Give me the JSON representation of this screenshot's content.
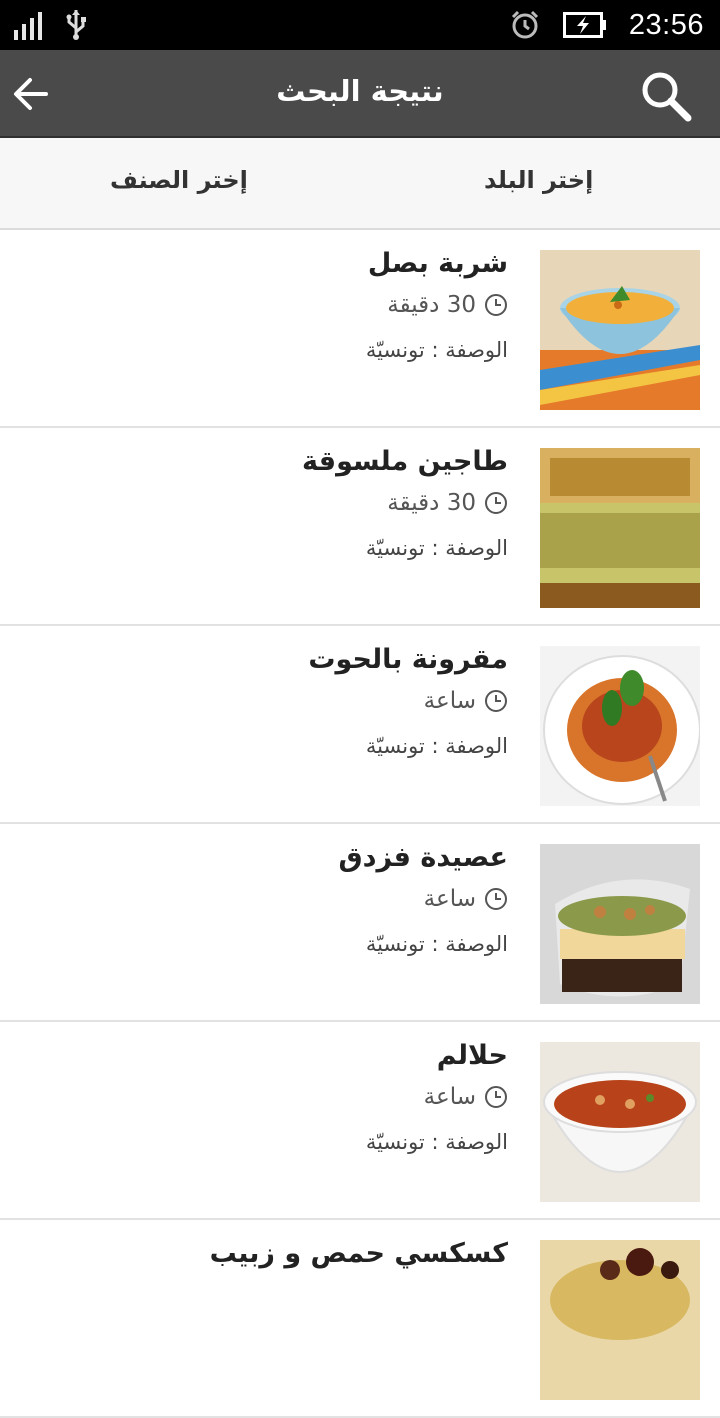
{
  "status_bar": {
    "time": "23:56"
  },
  "app_bar": {
    "title": "نتيجة البحث"
  },
  "filters": {
    "country": "إختر البلد",
    "category": "إختر الصنف"
  },
  "recipes": [
    {
      "name": "شربة بصل",
      "time": "30 دقيقة",
      "origin": "الوصفة : تونسيّة",
      "image": "soup-bowl"
    },
    {
      "name": "طاجين ملسوقة",
      "time": "30 دقيقة",
      "origin": "الوصفة : تونسيّة",
      "image": "tajine"
    },
    {
      "name": "مقرونة بالحوت",
      "time": "ساعة",
      "origin": "الوصفة : تونسيّة",
      "image": "pasta"
    },
    {
      "name": "عصيدة فزدق",
      "time": "ساعة",
      "origin": "الوصفة : تونسيّة",
      "image": "dessert-cup"
    },
    {
      "name": "حلالم",
      "time": "ساعة",
      "origin": "الوصفة : تونسيّة",
      "image": "soup-bowl"
    },
    {
      "name": "كسكسي حمص و زبيب",
      "time": "",
      "origin": "",
      "image": "couscous"
    }
  ]
}
